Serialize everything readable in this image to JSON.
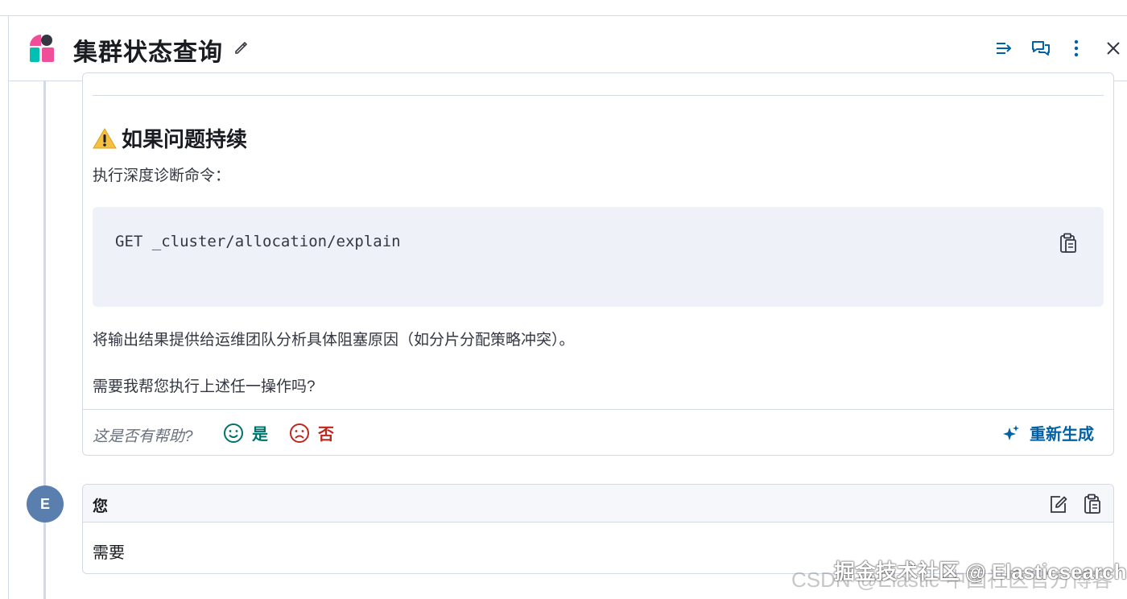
{
  "header": {
    "title": "集群状态查询",
    "icons": [
      "logo-icon",
      "pencil-icon",
      "list-indent-icon",
      "chat-bubbles-icon",
      "more-vertical-icon",
      "close-icon"
    ]
  },
  "assistant_message": {
    "section_heading": "如果问题持续",
    "intro_text": "执行深度诊断命令：",
    "code": "GET _cluster/allocation/explain",
    "followup_text": "将输出结果提供给运维团队分析具体阻塞原因（如分片分配策略冲突）。",
    "question_text": "需要我帮您执行上述任一操作吗?",
    "feedback": {
      "question": "这是否有帮助?",
      "yes_label": "是",
      "no_label": "否",
      "regenerate_label": "重新生成"
    }
  },
  "user_message": {
    "avatar_initial": "E",
    "author": "您",
    "text": "需要"
  },
  "watermark": {
    "line1": "CSDN @Elastic 中国社区官方博客",
    "line2": "掘金技术社区 @ Elasticsearch"
  },
  "colors": {
    "accent": "#0061a6",
    "positive": "#00726b",
    "negative": "#bd271e",
    "avatar_bg": "#5a7fae",
    "code_bg": "#eef1f8"
  }
}
